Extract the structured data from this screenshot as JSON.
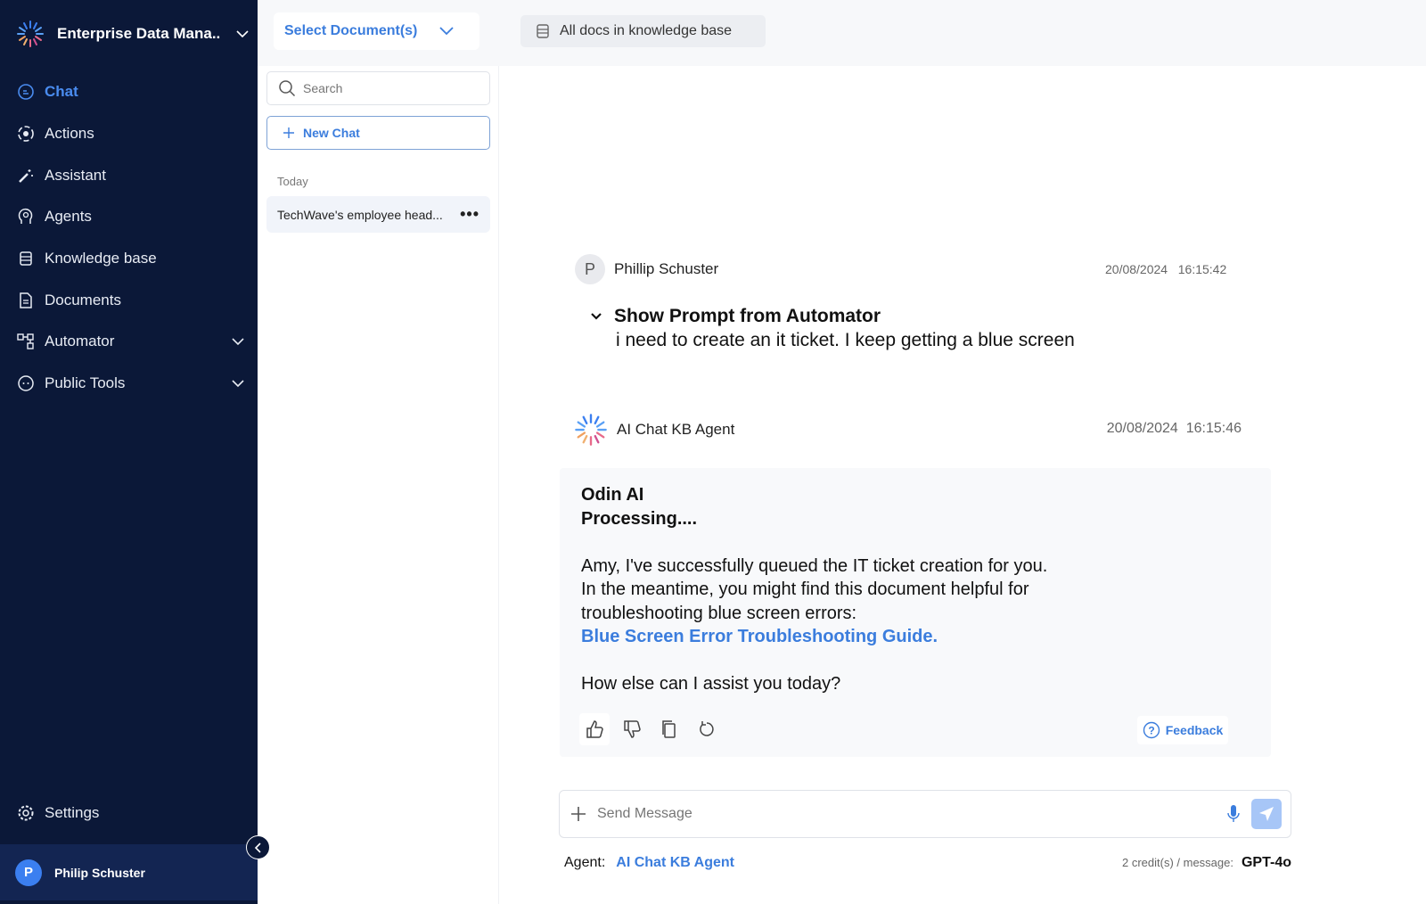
{
  "colors": {
    "sidebar_bg": "#0b1838",
    "accent": "#3b7ddd",
    "send_button": "#a7c6f7"
  },
  "sidebar": {
    "workspace": "Enterprise Data Mana..",
    "items": [
      {
        "label": "Chat",
        "icon": "chat-bubble-icon",
        "active": true
      },
      {
        "label": "Actions",
        "icon": "actions-gear-icon"
      },
      {
        "label": "Assistant",
        "icon": "magic-wand-icon"
      },
      {
        "label": "Agents",
        "icon": "agent-head-icon"
      },
      {
        "label": "Knowledge base",
        "icon": "database-icon"
      },
      {
        "label": "Documents",
        "icon": "document-icon"
      },
      {
        "label": "Automator",
        "icon": "flow-icon",
        "expandable": true
      },
      {
        "label": "Public Tools",
        "icon": "public-chat-icon",
        "expandable": true
      }
    ],
    "settings": "Settings",
    "user": {
      "initial": "P",
      "name": "Philip Schuster"
    }
  },
  "topbar": {
    "select_documents": "Select Document(s)",
    "scope": "All docs in knowledge base"
  },
  "history": {
    "search_placeholder": "Search",
    "new_chat": "New Chat",
    "groups": [
      {
        "label": "Today",
        "items": [
          "TechWave's employee head..."
        ]
      }
    ]
  },
  "conversation": {
    "user_msg": {
      "initial": "P",
      "author": "Phillip Schuster",
      "date": "20/08/2024",
      "time": "16:15:42",
      "toggle": "Show Prompt from Automator",
      "text": "i need to create an it ticket. I keep getting a blue screen"
    },
    "agent_msg": {
      "author": "AI Chat KB Agent",
      "date": "20/08/2024",
      "time": "16:15:46",
      "title1": "Odin AI",
      "title2": "Processing....",
      "lines": [
        "Amy, I've successfully queued the IT ticket creation for you.",
        "In the meantime, you might find this document helpful for",
        "troubleshooting blue screen errors:"
      ],
      "link": "Blue Screen Error Troubleshooting Guide.",
      "closing": "How else can I assist you today?",
      "feedback": "Feedback"
    }
  },
  "composer": {
    "placeholder": "Send Message",
    "agent_label": "Agent:",
    "agent_name": "AI Chat KB Agent",
    "credits": "2 credit(s) / message:",
    "model": "GPT-4o"
  }
}
